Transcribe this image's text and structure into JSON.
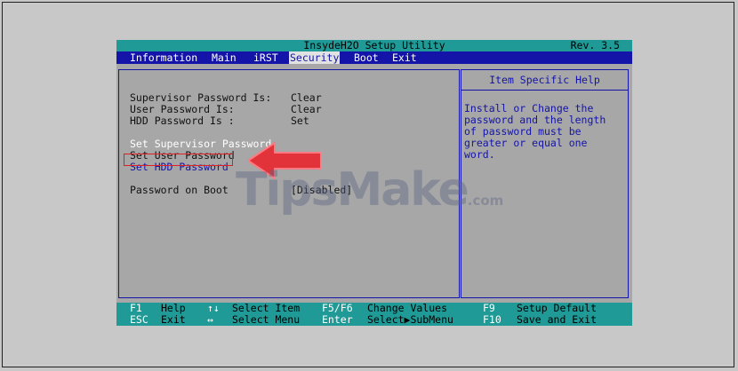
{
  "title": "InsydeH2O Setup Utility",
  "revision": "Rev. 3.5",
  "menu": [
    "Information",
    "Main",
    "iRST",
    "Security",
    "Boot",
    "Exit"
  ],
  "active_menu": "Security",
  "status": [
    {
      "label": "Supervisor Password Is:",
      "value": "Clear"
    },
    {
      "label": "User Password Is:",
      "value": "Clear"
    },
    {
      "label": "HDD Password Is :",
      "value": "Set"
    }
  ],
  "actions": [
    "Set Supervisor Password",
    "Set User Password",
    "Set HDD Password"
  ],
  "boot_option": {
    "label": "Password on Boot",
    "value": "[Disabled]"
  },
  "help": {
    "title": "Item Specific Help",
    "lines": [
      "Install or Change the",
      "password and the length",
      "of password  must be",
      "greater or equal one",
      "word."
    ]
  },
  "footer": [
    {
      "key": "F1",
      "desc": "Help"
    },
    {
      "key": "ESC",
      "desc": "Exit"
    },
    {
      "key": "↑↓",
      "desc": "Select Item"
    },
    {
      "key": "↔",
      "desc": "Select Menu"
    },
    {
      "key": "F5/F6",
      "desc": "Change Values"
    },
    {
      "key": "Enter",
      "desc": "Select▶SubMenu"
    },
    {
      "key": "F9",
      "desc": "Setup Default"
    },
    {
      "key": "F10",
      "desc": "Save and Exit"
    }
  ],
  "watermark": {
    "brand": "TipsMake",
    "suffix": ".com"
  },
  "colors": {
    "teal": "#1f9a96",
    "blue": "#1414a8",
    "panel": "#a7a7a7",
    "highlight": "#e02020"
  }
}
